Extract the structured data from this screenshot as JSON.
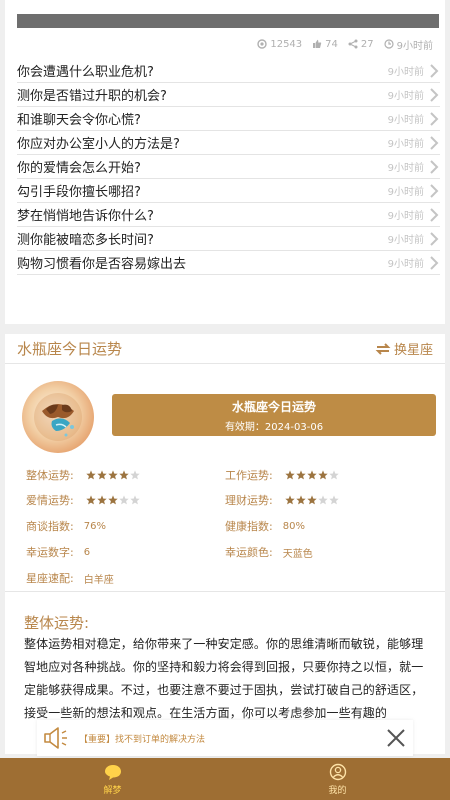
{
  "article": {
    "stats": {
      "views": "12543",
      "likes": "74",
      "shares": "27",
      "time": "9小时前"
    },
    "items": [
      {
        "title": "你会遭遇什么职业危机?",
        "time": "9小时前"
      },
      {
        "title": "测你是否错过升职的机会?",
        "time": "9小时前"
      },
      {
        "title": "和谁聊天会令你心慌?",
        "time": "9小时前"
      },
      {
        "title": "你应对办公室小人的方法是?",
        "time": "9小时前"
      },
      {
        "title": "你的爱情会怎么开始?",
        "time": "9小时前"
      },
      {
        "title": "勾引手段你擅长哪招?",
        "time": "9小时前"
      },
      {
        "title": "梦在悄悄地告诉你什么?",
        "time": "9小时前"
      },
      {
        "title": "测你能被暗恋多长时间?",
        "time": "9小时前"
      },
      {
        "title": "购物习惯看你是否容易嫁出去",
        "time": "9小时前"
      }
    ]
  },
  "horoscope": {
    "title": "水瓶座今日运势",
    "switch_label": "换星座",
    "banner_title": "水瓶座今日运势",
    "banner_valid": "有效期：2024-03-06",
    "stats": {
      "overall": {
        "label": "整体运势:",
        "rating": 4,
        "max": 5
      },
      "work": {
        "label": "工作运势:",
        "rating": 4,
        "max": 5
      },
      "love": {
        "label": "爱情运势:",
        "rating": 3,
        "max": 5
      },
      "finance": {
        "label": "理财运势:",
        "rating": 3,
        "max": 5
      },
      "negotiation": {
        "label": "商谈指数:",
        "value": "76%"
      },
      "health": {
        "label": "健康指数:",
        "value": "80%"
      },
      "lucky_number": {
        "label": "幸运数字:",
        "value": "6"
      },
      "lucky_color": {
        "label": "幸运颜色:",
        "value": "天蓝色"
      },
      "match": {
        "label": "星座速配:",
        "value": "白羊座"
      }
    },
    "overall_heading": "整体运势:",
    "overall_text": "整体运势相对稳定，给你带来了一种安定感。你的思维清晰而敏锐，能够理智地应对各种挑战。你的坚持和毅力将会得到回报，只要你持之以恒，就一定能够获得成果。不过，也要注意不要过于固执，尝试打破自己的舒适区，接受一些新的想法和观点。在生活方面，你可以考虑参加一些有趣的"
  },
  "notice": {
    "text": "【重要】找不到订单的解决方法",
    "icon": "speaker-icon"
  },
  "nav": {
    "tabs": [
      {
        "label": "解梦",
        "icon": "dream-bubble-icon",
        "active": true
      },
      {
        "label": "我的",
        "icon": "profile-icon",
        "active": false
      }
    ]
  },
  "colors": {
    "accent": "#b8864b",
    "banner": "#be8c45",
    "nav_bg": "#9e6e33",
    "active_tab": "#ffd24a",
    "star_on": "#9c7440",
    "star_off": "#d4d4d4"
  }
}
